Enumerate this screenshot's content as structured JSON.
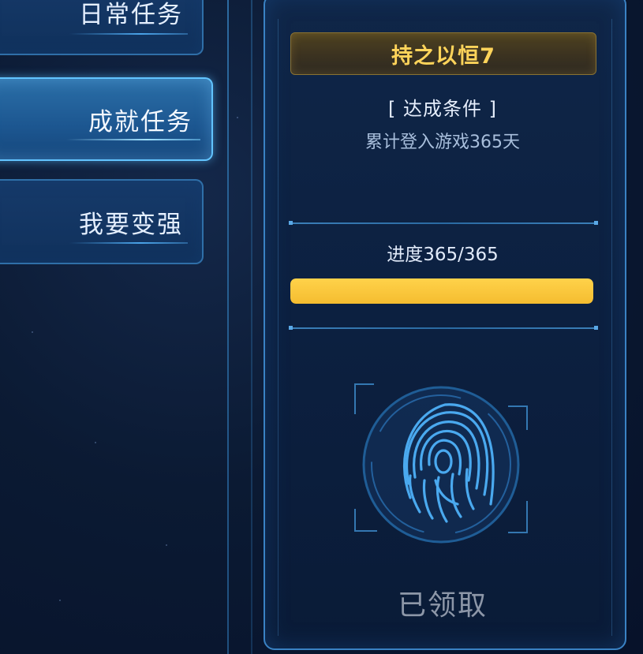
{
  "tabs": [
    {
      "id": "daily",
      "label": "日常任务"
    },
    {
      "id": "achievement",
      "label": "成就任务",
      "active": true
    },
    {
      "id": "become_stronger",
      "label": "我要变强"
    }
  ],
  "card": {
    "title": "持之以恒7",
    "condition_header": "[ 达成条件 ]",
    "condition_text": "累计登入游戏365天",
    "progress_label": "进度365/365",
    "progress": {
      "current": 365,
      "total": 365,
      "fraction": 1.0
    },
    "status": "已领取",
    "icon": "fingerprint-icon"
  },
  "colors": {
    "title_gold": "#ffd45a",
    "progress_fill": "#f5bd30",
    "accent_blue": "#3a82c4",
    "claimed_gray": "#8d97a8"
  }
}
